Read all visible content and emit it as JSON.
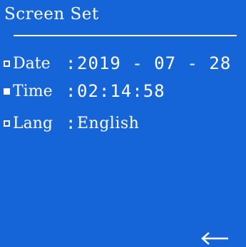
{
  "header": {
    "title": "Screen Set"
  },
  "menu": {
    "items": [
      {
        "label": "Date",
        "separator": ":",
        "value": "2019 - 07 - 28",
        "selected": false
      },
      {
        "label": "Time",
        "separator": ":",
        "value": "02:14:58",
        "selected": true
      },
      {
        "label": "Lang",
        "separator": ":",
        "value": "English",
        "selected": false
      }
    ]
  },
  "footer": {
    "back_icon": "left-arrow-icon"
  },
  "colors": {
    "background": "#1565d8",
    "foreground": "#ffffff"
  }
}
